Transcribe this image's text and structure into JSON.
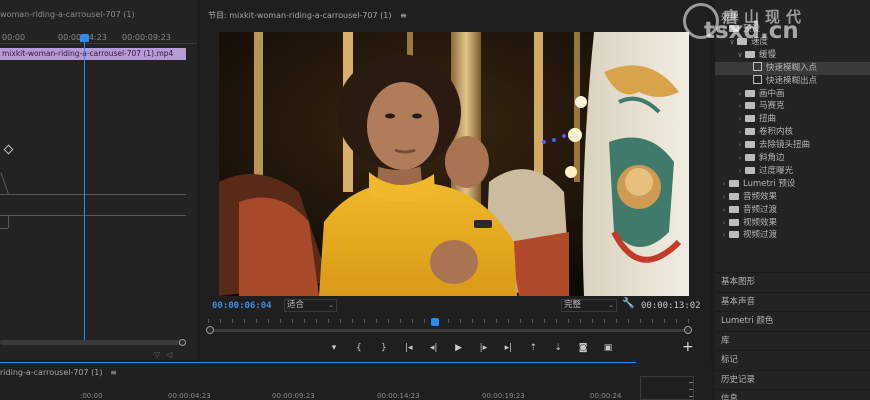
{
  "source_panel": {
    "tab_label": "woman-riding-a-carrousel-707 (1)",
    "ruler": [
      "00:00",
      "00:00:04:23",
      "00:00:09:23"
    ],
    "clip_label": "mixkit-woman-riding-a-carrousel-707 (1).mp4"
  },
  "program_monitor": {
    "title": "节目: mixkit-woman-riding-a-carrousel-707 (1)",
    "menu_glyph": "≡",
    "timecode_current": "00:00:06:04",
    "fit": "适合",
    "quality": "完整",
    "timecode_duration": "00:00:13:02",
    "playhead_fraction": 0.47,
    "transport": [
      {
        "name": "marker-icon",
        "glyph": "▾"
      },
      {
        "name": "mark-in-icon",
        "glyph": "{"
      },
      {
        "name": "mark-out-icon",
        "glyph": "}"
      },
      {
        "name": "go-to-in-icon",
        "glyph": "|◂"
      },
      {
        "name": "step-back-icon",
        "glyph": "◂|"
      },
      {
        "name": "play-icon",
        "glyph": "▶"
      },
      {
        "name": "step-forward-icon",
        "glyph": "|▸"
      },
      {
        "name": "go-to-out-icon",
        "glyph": "▸|"
      },
      {
        "name": "lift-icon",
        "glyph": "⇡"
      },
      {
        "name": "extract-icon",
        "glyph": "⇣"
      },
      {
        "name": "camera-icon",
        "glyph": "◙"
      },
      {
        "name": "compare-icon",
        "glyph": "▣"
      }
    ],
    "add_glyph": "+"
  },
  "effects_panel": {
    "title": "效果",
    "watermark": {
      "cn": "唐山现代",
      "en": "tsxd.cn"
    },
    "tree": [
      {
        "indent": 1,
        "twisty": "∨",
        "icon": "folder",
        "label": "预设"
      },
      {
        "indent": 2,
        "twisty": "∨",
        "icon": "folder",
        "label": "速度"
      },
      {
        "indent": 3,
        "twisty": "∨",
        "icon": "folder",
        "label": "缓慢"
      },
      {
        "indent": 4,
        "twisty": "",
        "icon": "fx",
        "label": "快速模糊入点",
        "selected": true
      },
      {
        "indent": 4,
        "twisty": "",
        "icon": "fx",
        "label": "快速模糊出点"
      },
      {
        "indent": 3,
        "twisty": "›",
        "icon": "folder",
        "label": "画中画"
      },
      {
        "indent": 3,
        "twisty": "›",
        "icon": "folder",
        "label": "马赛克"
      },
      {
        "indent": 3,
        "twisty": "›",
        "icon": "folder",
        "label": "扭曲"
      },
      {
        "indent": 3,
        "twisty": "›",
        "icon": "folder",
        "label": "卷积内核"
      },
      {
        "indent": 3,
        "twisty": "›",
        "icon": "folder",
        "label": "去除镜头扭曲"
      },
      {
        "indent": 3,
        "twisty": "›",
        "icon": "folder",
        "label": "斜角边"
      },
      {
        "indent": 3,
        "twisty": "›",
        "icon": "folder",
        "label": "过度曝光"
      },
      {
        "indent": 1,
        "twisty": "›",
        "icon": "folder",
        "label": "Lumetri 预设"
      },
      {
        "indent": 1,
        "twisty": "›",
        "icon": "folder",
        "label": "音频效果"
      },
      {
        "indent": 1,
        "twisty": "›",
        "icon": "folder",
        "label": "音频过渡"
      },
      {
        "indent": 1,
        "twisty": "›",
        "icon": "folder",
        "label": "视频效果"
      },
      {
        "indent": 1,
        "twisty": "›",
        "icon": "folder",
        "label": "视频过渡"
      }
    ],
    "sections": [
      "基本图形",
      "基本声音",
      "Lumetri 颜色",
      "库",
      "标记",
      "历史记录",
      "信息"
    ]
  },
  "timeline": {
    "title": "riding-a-carrousel-707 (1)",
    "menu_glyph": "≡",
    "ruler": [
      ":00:00",
      "00:00:04:23",
      "00:00:09:23",
      "00:00:14:23",
      "00:00:19:23",
      "00:00:24"
    ]
  },
  "colors": {
    "accent_blue": "#2d8ceb",
    "clip_purple": "#b79bd6",
    "panel_bg": "#232323"
  }
}
